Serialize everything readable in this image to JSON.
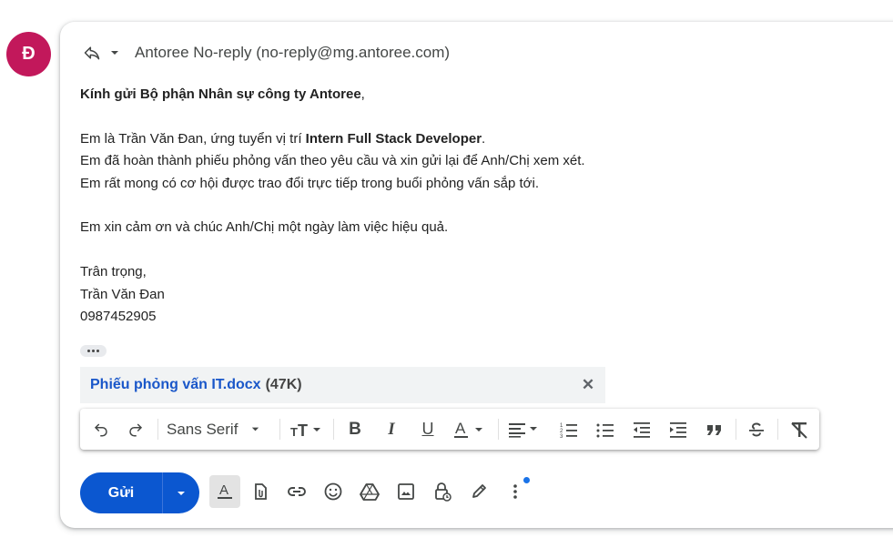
{
  "avatar": {
    "letter": "Đ",
    "color": "#c2185b"
  },
  "header": {
    "sender": "Antoree No-reply (no-reply@mg.antoree.com)"
  },
  "body": {
    "greeting_bold": "Kính gửi Bộ phận Nhân sự công ty Antoree",
    "greeting_tail": ",",
    "line1_pre": "Em là Trần Văn Đan, ứng tuyển vị trí ",
    "line1_bold": "Intern Full Stack Developer",
    "line1_post": ".",
    "line2": "Em đã hoàn thành phiếu phỏng vấn theo yêu cầu và xin gửi lại để Anh/Chị xem xét.",
    "line3": "Em rất mong có cơ hội được trao đổi trực tiếp trong buổi phỏng vấn sắp tới.",
    "line4": "Em xin cảm ơn và chúc Anh/Chị một ngày làm việc hiệu quả.",
    "sign_off": "Trân trọng,",
    "sign_name": "Trần Văn Đan",
    "sign_phone": "0987452905"
  },
  "attachment": {
    "name": "Phiếu phỏng vấn IT.docx",
    "size": "(47K)"
  },
  "toolbar": {
    "font": "Sans Serif"
  },
  "send": {
    "label": "Gửi"
  },
  "colors": {
    "accent": "#0b57d0",
    "link": "#1a57c9",
    "dot": "#1a73e8"
  }
}
